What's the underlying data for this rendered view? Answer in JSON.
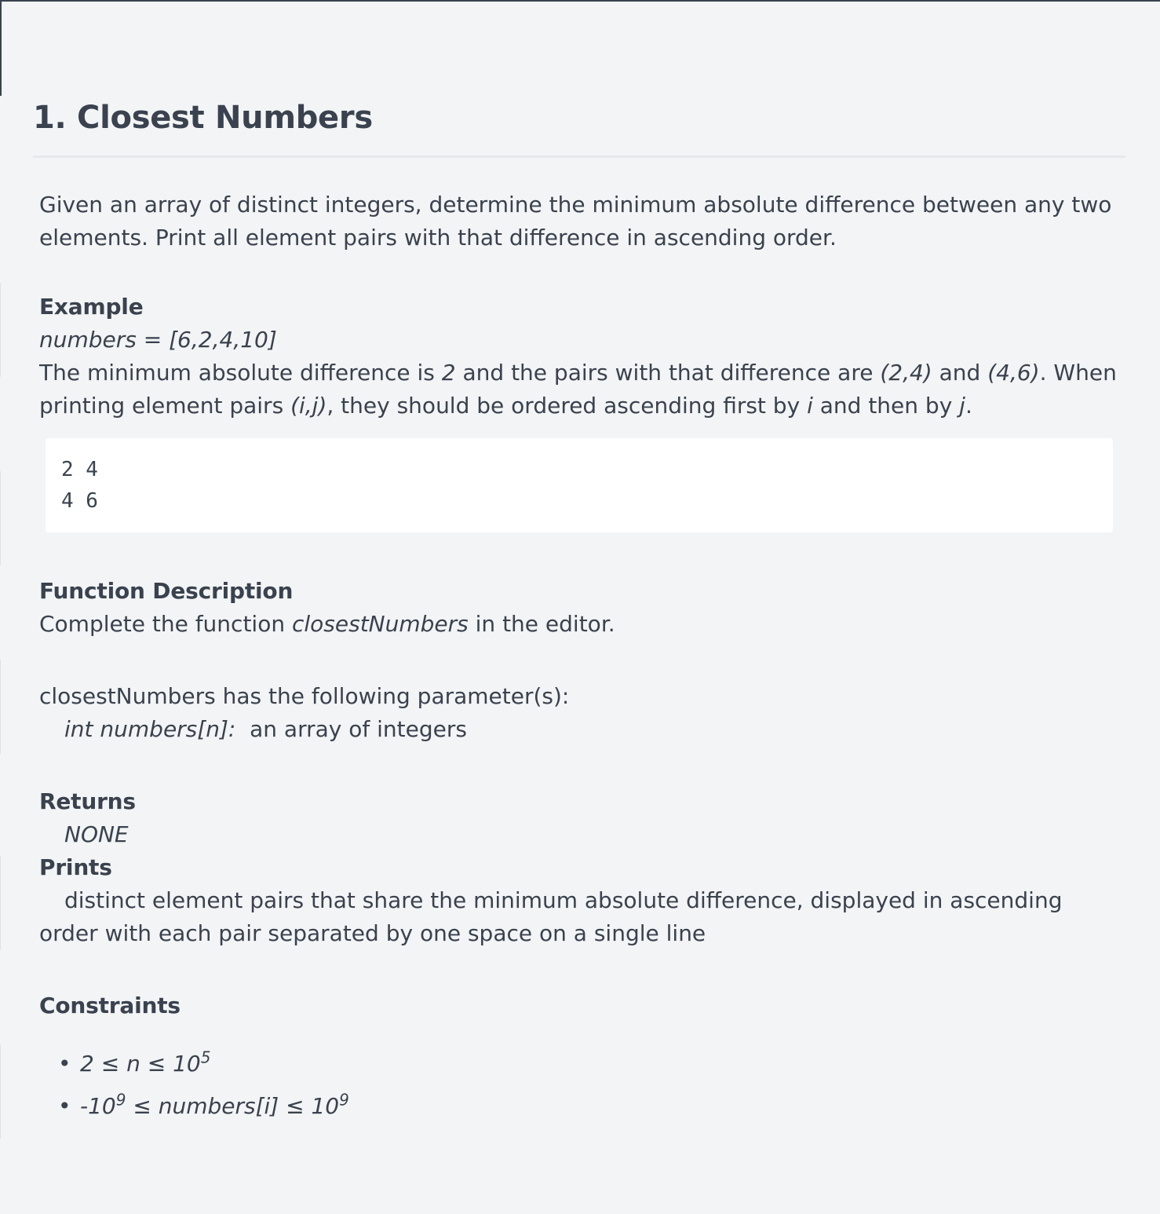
{
  "problem": {
    "title": "1. Closest Numbers",
    "intro": "Given an array of distinct integers, determine the minimum absolute difference between any two elements. Print all element pairs with that difference in ascending order.",
    "example": {
      "heading": "Example",
      "input": "numbers = [6,2,4,10]",
      "explanation": {
        "part1": "The minimum absolute difference is ",
        "min_diff": "2",
        "part2": " and the pairs with that difference are ",
        "pair1": "(2,4)",
        "part3": " and ",
        "pair2": "(4,6)",
        "part4": ". When printing element pairs ",
        "pair_generic": "(i,j)",
        "part5": ", they should be ordered ascending first by ",
        "var_i": "i",
        "part6": " and then by ",
        "var_j": "j",
        "part7": "."
      },
      "output_lines": [
        "2 4",
        "4 6"
      ]
    },
    "function_description": {
      "heading": "Function Description",
      "text_before": "Complete the function ",
      "function_name": "closestNumbers",
      "text_after": " in the editor.",
      "params_intro": "closestNumbers has the following parameter(s):",
      "param_signature": "int numbers[n]:",
      "param_description": "  an array of integers"
    },
    "returns": {
      "heading": "Returns",
      "value": "NONE"
    },
    "prints": {
      "heading": "Prints",
      "text": "distinct element pairs that share the minimum absolute difference, displayed in ascending order with each pair separated by one space on a single line"
    },
    "constraints": {
      "heading": "Constraints",
      "items": [
        {
          "bullet": "•",
          "left": "2 ≤ n ≤ 10",
          "sup": "5",
          "right": ""
        },
        {
          "bullet": "•",
          "left": "-10",
          "sup": "9",
          "right": " ≤ numbers[i] ≤ 10",
          "sup2": "9"
        }
      ]
    }
  }
}
